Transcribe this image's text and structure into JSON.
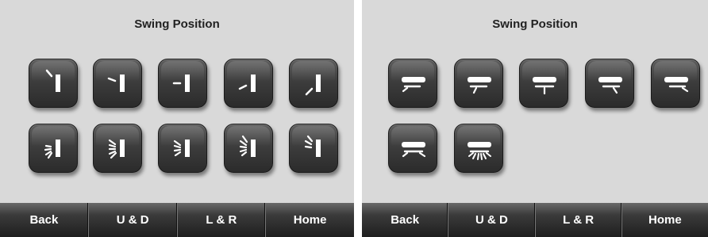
{
  "left_panel": {
    "title": "Swing Position",
    "nav": [
      "Back",
      "U & D",
      "L & R",
      "Home"
    ],
    "buttons": [
      {
        "name": "swing-pos-1-icon"
      },
      {
        "name": "swing-pos-2-icon"
      },
      {
        "name": "swing-pos-3-icon"
      },
      {
        "name": "swing-pos-4-icon"
      },
      {
        "name": "swing-pos-5-icon"
      },
      {
        "name": "swing-sweep-1-icon"
      },
      {
        "name": "swing-sweep-2-icon"
      },
      {
        "name": "swing-sweep-3-icon"
      },
      {
        "name": "swing-sweep-4-icon"
      },
      {
        "name": "swing-sweep-5-icon"
      }
    ]
  },
  "right_panel": {
    "title": "Swing Position",
    "nav": [
      "Back",
      "U & D",
      "L & R",
      "Home"
    ],
    "buttons": [
      {
        "name": "ud-pos-1-icon"
      },
      {
        "name": "ud-pos-2-icon"
      },
      {
        "name": "ud-pos-3-icon"
      },
      {
        "name": "ud-pos-4-icon"
      },
      {
        "name": "ud-pos-5-icon"
      },
      {
        "name": "ud-sweep-1-icon"
      },
      {
        "name": "ud-sweep-2-icon"
      }
    ]
  },
  "colors": {
    "panel_bg": "#d9d9d9",
    "button": "#3d3d3d",
    "icon": "#ffffff"
  }
}
